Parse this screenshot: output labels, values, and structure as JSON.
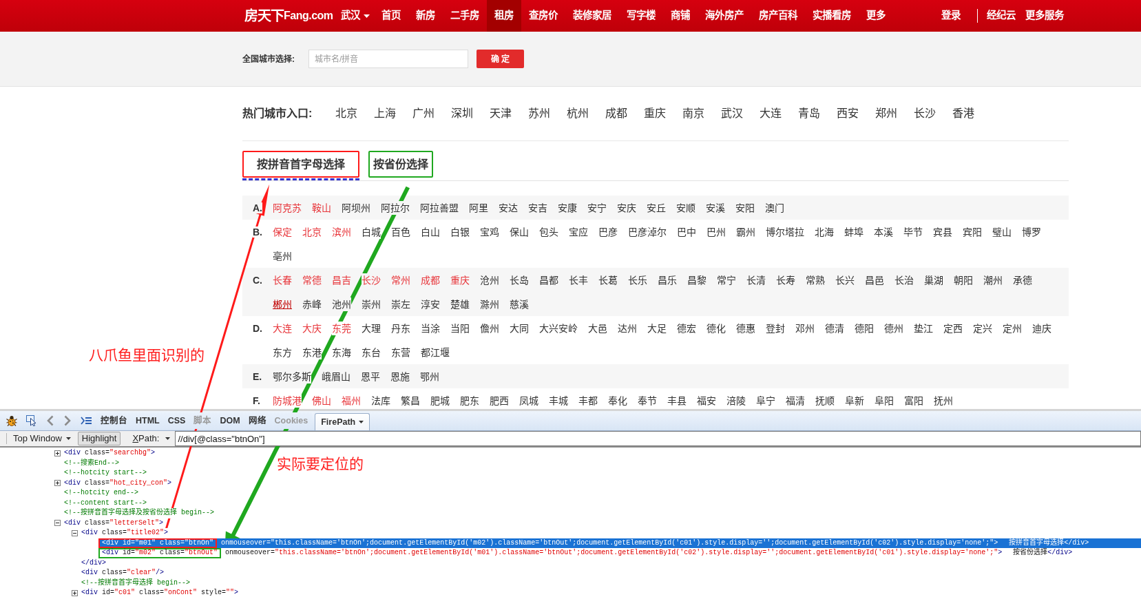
{
  "topnav": {
    "logo_cn": "房天下",
    "logo_en": "Fang.com",
    "city": "武汉",
    "items": [
      {
        "label": "首页",
        "selected": false
      },
      {
        "label": "新房",
        "selected": false
      },
      {
        "label": "二手房",
        "selected": false
      },
      {
        "label": "租房",
        "selected": true
      },
      {
        "label": "查房价",
        "selected": false
      },
      {
        "label": "装修家居",
        "selected": false
      },
      {
        "label": "写字楼",
        "selected": false
      },
      {
        "label": "商铺",
        "selected": false
      },
      {
        "label": "海外房产",
        "selected": false
      },
      {
        "label": "房产百科",
        "selected": false
      },
      {
        "label": "实播看房",
        "selected": false
      },
      {
        "label": "更多",
        "selected": false
      }
    ],
    "login": "登录",
    "links": [
      "经纪云",
      "更多服务"
    ]
  },
  "city_search": {
    "label": "全国城市选择:",
    "placeholder": "城市名/拼音",
    "button": "确 定"
  },
  "hot_cities": {
    "label": "热门城市入口:",
    "cities": [
      "北京",
      "上海",
      "广州",
      "深圳",
      "天津",
      "苏州",
      "杭州",
      "成都",
      "重庆",
      "南京",
      "武汉",
      "大连",
      "青岛",
      "西安",
      "郑州",
      "长沙",
      "香港"
    ]
  },
  "tabs": [
    {
      "label": "按拼音首字母选择",
      "selected": true,
      "color": "#ff1a1a"
    },
    {
      "label": "按省份选择",
      "selected": false,
      "color": "#1fa81f"
    }
  ],
  "letter_groups": [
    {
      "letter": "A.",
      "cities": [
        {
          "name": "阿克苏",
          "hot": true,
          "hovered": false
        },
        {
          "name": "鞍山",
          "hot": true,
          "hovered": false
        },
        {
          "name": "阿坝州",
          "hot": false,
          "hovered": false
        },
        {
          "name": "阿拉尔",
          "hot": false,
          "hovered": false
        },
        {
          "name": "阿拉善盟",
          "hot": false,
          "hovered": false
        },
        {
          "name": "阿里",
          "hot": false,
          "hovered": false
        },
        {
          "name": "安达",
          "hot": false,
          "hovered": false
        },
        {
          "name": "安吉",
          "hot": false,
          "hovered": false
        },
        {
          "name": "安康",
          "hot": false,
          "hovered": false
        },
        {
          "name": "安宁",
          "hot": false,
          "hovered": false
        },
        {
          "name": "安庆",
          "hot": false,
          "hovered": false
        },
        {
          "name": "安丘",
          "hot": false,
          "hovered": false
        },
        {
          "name": "安顺",
          "hot": false,
          "hovered": false
        },
        {
          "name": "安溪",
          "hot": false,
          "hovered": false
        },
        {
          "name": "安阳",
          "hot": false,
          "hovered": false
        },
        {
          "name": "澳门",
          "hot": false,
          "hovered": false
        }
      ]
    },
    {
      "letter": "B.",
      "cities": [
        {
          "name": "保定",
          "hot": true,
          "hovered": false
        },
        {
          "name": "北京",
          "hot": true,
          "hovered": false
        },
        {
          "name": "滨州",
          "hot": true,
          "hovered": false
        },
        {
          "name": "白城",
          "hot": false,
          "hovered": false
        },
        {
          "name": "百色",
          "hot": false,
          "hovered": false
        },
        {
          "name": "白山",
          "hot": false,
          "hovered": false
        },
        {
          "name": "白银",
          "hot": false,
          "hovered": false
        },
        {
          "name": "宝鸡",
          "hot": false,
          "hovered": false
        },
        {
          "name": "保山",
          "hot": false,
          "hovered": false
        },
        {
          "name": "包头",
          "hot": false,
          "hovered": false
        },
        {
          "name": "宝应",
          "hot": false,
          "hovered": false
        },
        {
          "name": "巴彦",
          "hot": false,
          "hovered": false
        },
        {
          "name": "巴彦淖尔",
          "hot": false,
          "hovered": false
        },
        {
          "name": "巴中",
          "hot": false,
          "hovered": false
        },
        {
          "name": "巴州",
          "hot": false,
          "hovered": false
        },
        {
          "name": "霸州",
          "hot": false,
          "hovered": false
        },
        {
          "name": "博尔塔拉",
          "hot": false,
          "hovered": false
        },
        {
          "name": "北海",
          "hot": false,
          "hovered": false
        },
        {
          "name": "蚌埠",
          "hot": false,
          "hovered": false
        },
        {
          "name": "本溪",
          "hot": false,
          "hovered": false
        },
        {
          "name": "毕节",
          "hot": false,
          "hovered": false
        },
        {
          "name": "宾县",
          "hot": false,
          "hovered": false
        },
        {
          "name": "宾阳",
          "hot": false,
          "hovered": false
        },
        {
          "name": "璧山",
          "hot": false,
          "hovered": false
        },
        {
          "name": "博罗",
          "hot": false,
          "hovered": false
        },
        {
          "name": "亳州",
          "hot": false,
          "hovered": false
        }
      ]
    },
    {
      "letter": "C.",
      "cities": [
        {
          "name": "长春",
          "hot": true,
          "hovered": false
        },
        {
          "name": "常德",
          "hot": true,
          "hovered": false
        },
        {
          "name": "昌吉",
          "hot": true,
          "hovered": false
        },
        {
          "name": "长沙",
          "hot": true,
          "hovered": false
        },
        {
          "name": "常州",
          "hot": true,
          "hovered": false
        },
        {
          "name": "成都",
          "hot": true,
          "hovered": false
        },
        {
          "name": "重庆",
          "hot": true,
          "hovered": false
        },
        {
          "name": "沧州",
          "hot": false,
          "hovered": false
        },
        {
          "name": "长岛",
          "hot": false,
          "hovered": false
        },
        {
          "name": "昌都",
          "hot": false,
          "hovered": false
        },
        {
          "name": "长丰",
          "hot": false,
          "hovered": false
        },
        {
          "name": "长葛",
          "hot": false,
          "hovered": false
        },
        {
          "name": "长乐",
          "hot": false,
          "hovered": false
        },
        {
          "name": "昌乐",
          "hot": false,
          "hovered": false
        },
        {
          "name": "昌黎",
          "hot": false,
          "hovered": false
        },
        {
          "name": "常宁",
          "hot": false,
          "hovered": false
        },
        {
          "name": "长清",
          "hot": false,
          "hovered": false
        },
        {
          "name": "长寿",
          "hot": false,
          "hovered": false
        },
        {
          "name": "常熟",
          "hot": false,
          "hovered": false
        },
        {
          "name": "长兴",
          "hot": false,
          "hovered": false
        },
        {
          "name": "昌邑",
          "hot": false,
          "hovered": false
        },
        {
          "name": "长治",
          "hot": false,
          "hovered": false
        },
        {
          "name": "巢湖",
          "hot": false,
          "hovered": false
        },
        {
          "name": "朝阳",
          "hot": false,
          "hovered": false
        },
        {
          "name": "潮州",
          "hot": false,
          "hovered": false
        },
        {
          "name": "承德",
          "hot": false,
          "hovered": false
        },
        {
          "name": "郴州",
          "hot": false,
          "hovered": true
        },
        {
          "name": "赤峰",
          "hot": false,
          "hovered": false
        },
        {
          "name": "池州",
          "hot": false,
          "hovered": false
        },
        {
          "name": "崇州",
          "hot": false,
          "hovered": false
        },
        {
          "name": "崇左",
          "hot": false,
          "hovered": false
        },
        {
          "name": "淳安",
          "hot": false,
          "hovered": false
        },
        {
          "name": "楚雄",
          "hot": false,
          "hovered": false
        },
        {
          "name": "滁州",
          "hot": false,
          "hovered": false
        },
        {
          "name": "慈溪",
          "hot": false,
          "hovered": false
        }
      ]
    },
    {
      "letter": "D.",
      "cities": [
        {
          "name": "大连",
          "hot": true,
          "hovered": false
        },
        {
          "name": "大庆",
          "hot": true,
          "hovered": false
        },
        {
          "name": "东莞",
          "hot": true,
          "hovered": false
        },
        {
          "name": "大理",
          "hot": false,
          "hovered": false
        },
        {
          "name": "丹东",
          "hot": false,
          "hovered": false
        },
        {
          "name": "当涂",
          "hot": false,
          "hovered": false
        },
        {
          "name": "当阳",
          "hot": false,
          "hovered": false
        },
        {
          "name": "儋州",
          "hot": false,
          "hovered": false
        },
        {
          "name": "大同",
          "hot": false,
          "hovered": false
        },
        {
          "name": "大兴安岭",
          "hot": false,
          "hovered": false
        },
        {
          "name": "大邑",
          "hot": false,
          "hovered": false
        },
        {
          "name": "达州",
          "hot": false,
          "hovered": false
        },
        {
          "name": "大足",
          "hot": false,
          "hovered": false
        },
        {
          "name": "德宏",
          "hot": false,
          "hovered": false
        },
        {
          "name": "德化",
          "hot": false,
          "hovered": false
        },
        {
          "name": "德惠",
          "hot": false,
          "hovered": false
        },
        {
          "name": "登封",
          "hot": false,
          "hovered": false
        },
        {
          "name": "邓州",
          "hot": false,
          "hovered": false
        },
        {
          "name": "德清",
          "hot": false,
          "hovered": false
        },
        {
          "name": "德阳",
          "hot": false,
          "hovered": false
        },
        {
          "name": "德州",
          "hot": false,
          "hovered": false
        },
        {
          "name": "垫江",
          "hot": false,
          "hovered": false
        },
        {
          "name": "定西",
          "hot": false,
          "hovered": false
        },
        {
          "name": "定兴",
          "hot": false,
          "hovered": false
        },
        {
          "name": "定州",
          "hot": false,
          "hovered": false
        },
        {
          "name": "迪庆",
          "hot": false,
          "hovered": false
        },
        {
          "name": "东方",
          "hot": false,
          "hovered": false
        },
        {
          "name": "东港",
          "hot": false,
          "hovered": false
        },
        {
          "name": "东海",
          "hot": false,
          "hovered": false
        },
        {
          "name": "东台",
          "hot": false,
          "hovered": false
        },
        {
          "name": "东营",
          "hot": false,
          "hovered": false
        },
        {
          "name": "都江堰",
          "hot": false,
          "hovered": false
        }
      ]
    },
    {
      "letter": "E.",
      "cities": [
        {
          "name": "鄂尔多斯",
          "hot": false,
          "hovered": false
        },
        {
          "name": "峨眉山",
          "hot": false,
          "hovered": false
        },
        {
          "name": "恩平",
          "hot": false,
          "hovered": false
        },
        {
          "name": "恩施",
          "hot": false,
          "hovered": false
        },
        {
          "name": "鄂州",
          "hot": false,
          "hovered": false
        }
      ]
    },
    {
      "letter": "F.",
      "cities": [
        {
          "name": "防城港",
          "hot": true,
          "hovered": false
        },
        {
          "name": "佛山",
          "hot": true,
          "hovered": false
        },
        {
          "name": "福州",
          "hot": true,
          "hovered": false
        },
        {
          "name": "法库",
          "hot": false,
          "hovered": false
        },
        {
          "name": "繁昌",
          "hot": false,
          "hovered": false
        },
        {
          "name": "肥城",
          "hot": false,
          "hovered": false
        },
        {
          "name": "肥东",
          "hot": false,
          "hovered": false
        },
        {
          "name": "肥西",
          "hot": false,
          "hovered": false
        },
        {
          "name": "凤城",
          "hot": false,
          "hovered": false
        },
        {
          "name": "丰城",
          "hot": false,
          "hovered": false
        },
        {
          "name": "丰都",
          "hot": false,
          "hovered": false
        },
        {
          "name": "奉化",
          "hot": false,
          "hovered": false
        },
        {
          "name": "奉节",
          "hot": false,
          "hovered": false
        },
        {
          "name": "丰县",
          "hot": false,
          "hovered": false
        },
        {
          "name": "福安",
          "hot": false,
          "hovered": false
        },
        {
          "name": "涪陵",
          "hot": false,
          "hovered": false
        },
        {
          "name": "阜宁",
          "hot": false,
          "hovered": false
        },
        {
          "name": "福清",
          "hot": false,
          "hovered": false
        },
        {
          "name": "抚顺",
          "hot": false,
          "hovered": false
        },
        {
          "name": "阜新",
          "hot": false,
          "hovered": false
        },
        {
          "name": "阜阳",
          "hot": false,
          "hovered": false
        },
        {
          "name": "富阳",
          "hot": false,
          "hovered": false
        },
        {
          "name": "抚州",
          "hot": false,
          "hovered": false
        }
      ]
    }
  ],
  "devtools": {
    "tabs": [
      {
        "label": "控制台",
        "selected": false,
        "disabled": false
      },
      {
        "label": "HTML",
        "selected": false,
        "disabled": false
      },
      {
        "label": "CSS",
        "selected": false,
        "disabled": false
      },
      {
        "label": "脚本",
        "selected": false,
        "disabled": true
      },
      {
        "label": "DOM",
        "selected": false,
        "disabled": false
      },
      {
        "label": "网络",
        "selected": false,
        "disabled": false
      },
      {
        "label": "Cookies",
        "selected": false,
        "disabled": true
      },
      {
        "label": "FirePath",
        "selected": true,
        "disabled": false
      }
    ],
    "frame_menu": "Top Window",
    "highlight": "Highlight",
    "xpath_label": "XPath:",
    "xpath": "//div[@class=\"btnOn\"]",
    "tree": [
      {
        "kind": "element",
        "tag": "<div class=\"searchbg\">",
        "expanded": false,
        "selected": false
      },
      {
        "kind": "comment",
        "text": "<!--搜索End-->",
        "selected": false
      },
      {
        "kind": "comment",
        "text": "<!--hotcity start-->",
        "selected": false
      },
      {
        "kind": "element",
        "tag": "<div class=\"hot_city_con\">",
        "expanded": false,
        "selected": false
      },
      {
        "kind": "comment",
        "text": "<!--hotcity end-->",
        "selected": false
      },
      {
        "kind": "comment",
        "text": "<!--content start-->",
        "selected": false
      },
      {
        "kind": "comment",
        "text": "<!--按拼音首字母选择及按省份选择 begin-->",
        "selected": false
      },
      {
        "kind": "element",
        "tag": "<div class=\"letterSelt\">",
        "expanded": true,
        "selected": false,
        "children": [
          {
            "kind": "element",
            "tag": "<div class=\"title02\">",
            "expanded": true,
            "selected": false,
            "closing": "</div>",
            "children": [
              {
                "kind": "leaf",
                "tag": "<div id=\"m01\" class=\"btnOn\" onmouseover=\"this.className='btnOn';document.getElementById('m02').className='btnOut';document.getElementById('c01').style.display='';document.getElementById('c02').style.display='none';\">",
                "text": "按拼音首字母选择",
                "closing": "</div>",
                "selected": true,
                "color": "#ff1a1a"
              },
              {
                "kind": "leaf",
                "tag": "<div id=\"m02\" class=\"btnOut\" onmouseover=\"this.className='btnOn';document.getElementById('m01').className='btnOut';document.getElementById('c02').style.display='';document.getElementById('c01').style.display='none';\">",
                "text": "按省份选择",
                "closing": "</div>",
                "selected": false,
                "color": "#1fa81f"
              }
            ]
          },
          {
            "kind": "leaf",
            "tag": "<div class=\"clear\"/>",
            "selected": false
          },
          {
            "kind": "comment",
            "text": "<!--按拼音首字母选择 begin-->",
            "selected": false
          },
          {
            "kind": "element",
            "tag": "<div id=\"c01\" class=\"onCont\" style=\"\">",
            "expanded": false,
            "selected": false
          }
        ]
      }
    ]
  },
  "annotations": [
    {
      "kind": "uparrow",
      "color": "#ff1a1a"
    },
    {
      "kind": "downarrow",
      "color": "#1fa81f"
    },
    {
      "kind": "note",
      "text": "八爪鱼里面识别的"
    },
    {
      "kind": "note",
      "text": "实际要定位的"
    }
  ]
}
